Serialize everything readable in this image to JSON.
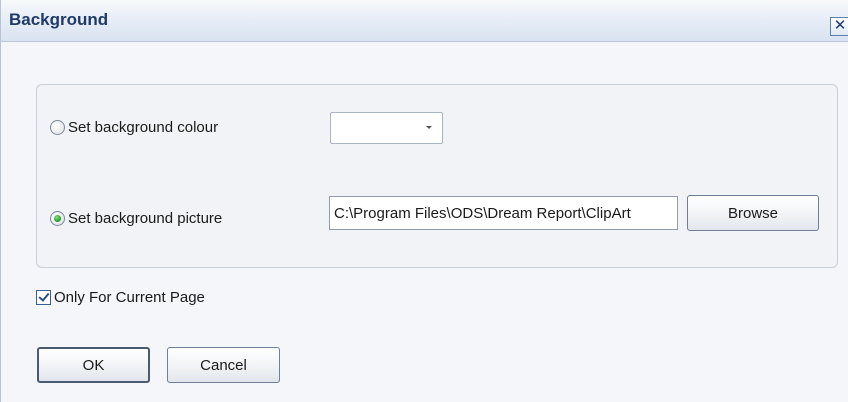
{
  "dialog": {
    "title": "Background",
    "close_glyph": "✕"
  },
  "background_colour": {
    "label": "Set background colour",
    "selected": false,
    "dropdown_value": ""
  },
  "background_picture": {
    "label": "Set background picture",
    "selected": true,
    "path_value": "C:\\Program Files\\ODS\\Dream Report\\ClipArt",
    "browse_label": "Browse"
  },
  "current_page": {
    "label": "Only For Current Page",
    "checked": true
  },
  "buttons": {
    "ok_label": "OK",
    "cancel_label": "Cancel"
  },
  "icons": {
    "close": "close-icon",
    "dropdown": "chevron-down-icon",
    "radio": "radio-icon",
    "checkbox": "checkmark-icon"
  }
}
